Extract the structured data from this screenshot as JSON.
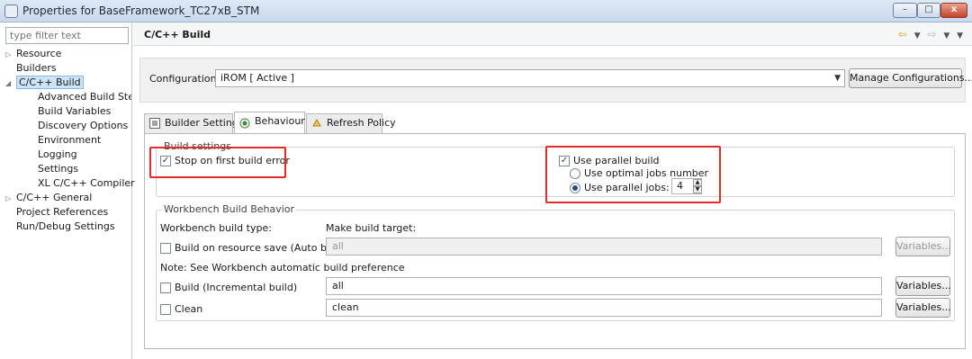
{
  "window": {
    "title": "Properties for BaseFramework_TC27xB_STM",
    "min_label": "–",
    "max_label": "□",
    "close_label": "x"
  },
  "sidebar": {
    "filter_placeholder": "type filter text",
    "items": [
      {
        "label": "Resource",
        "twisty": "▷"
      },
      {
        "label": "Builders",
        "twisty": ""
      },
      {
        "label": "C/C++ Build",
        "twisty": "◢"
      },
      {
        "label": "Advanced Build Steps",
        "twisty": ""
      },
      {
        "label": "Build Variables",
        "twisty": ""
      },
      {
        "label": "Discovery Options",
        "twisty": ""
      },
      {
        "label": "Environment",
        "twisty": ""
      },
      {
        "label": "Logging",
        "twisty": ""
      },
      {
        "label": "Settings",
        "twisty": ""
      },
      {
        "label": "XL C/C++ Compiler",
        "twisty": ""
      },
      {
        "label": "C/C++ General",
        "twisty": "▷"
      },
      {
        "label": "Project References",
        "twisty": ""
      },
      {
        "label": "Run/Debug Settings",
        "twisty": ""
      }
    ]
  },
  "header": {
    "title": "C/C++ Build",
    "nav_back": "⇦",
    "nav_fwd": "⇨",
    "caret": "▼"
  },
  "config": {
    "label": "Configuration:",
    "value": "iROM  [ Active ]",
    "dropdown": "▼",
    "manage_label": "Manage Configurations..."
  },
  "tabs": [
    {
      "label": "Builder Settings"
    },
    {
      "label": "Behaviour"
    },
    {
      "label": "Refresh Policy"
    }
  ],
  "build_settings": {
    "title": "Build settings",
    "stop_on_error": "Stop on first build error",
    "parallel_build": "Use parallel build",
    "optimal_jobs": "Use optimal jobs number",
    "parallel_jobs": "Use parallel jobs:",
    "jobs_value": "4",
    "check_mark": "✓",
    "spin_up": "▲",
    "spin_down": "▼"
  },
  "workbench": {
    "title": "Workbench Build Behavior",
    "type_label": "Workbench build type:",
    "target_label": "Make build target:",
    "auto_build_label": "Build on resource save (Auto build)",
    "auto_build_target": "all",
    "note": "Note: See Workbench automatic build preference",
    "incremental_label": "Build (Incremental build)",
    "incremental_target": "all",
    "clean_label": "Clean",
    "clean_target": "clean",
    "variables_label": "Variables..."
  },
  "colors": {
    "highlight_box": "#e62b2b",
    "selection": "#cde3f7",
    "nav_arrow": "#e0a21a"
  }
}
